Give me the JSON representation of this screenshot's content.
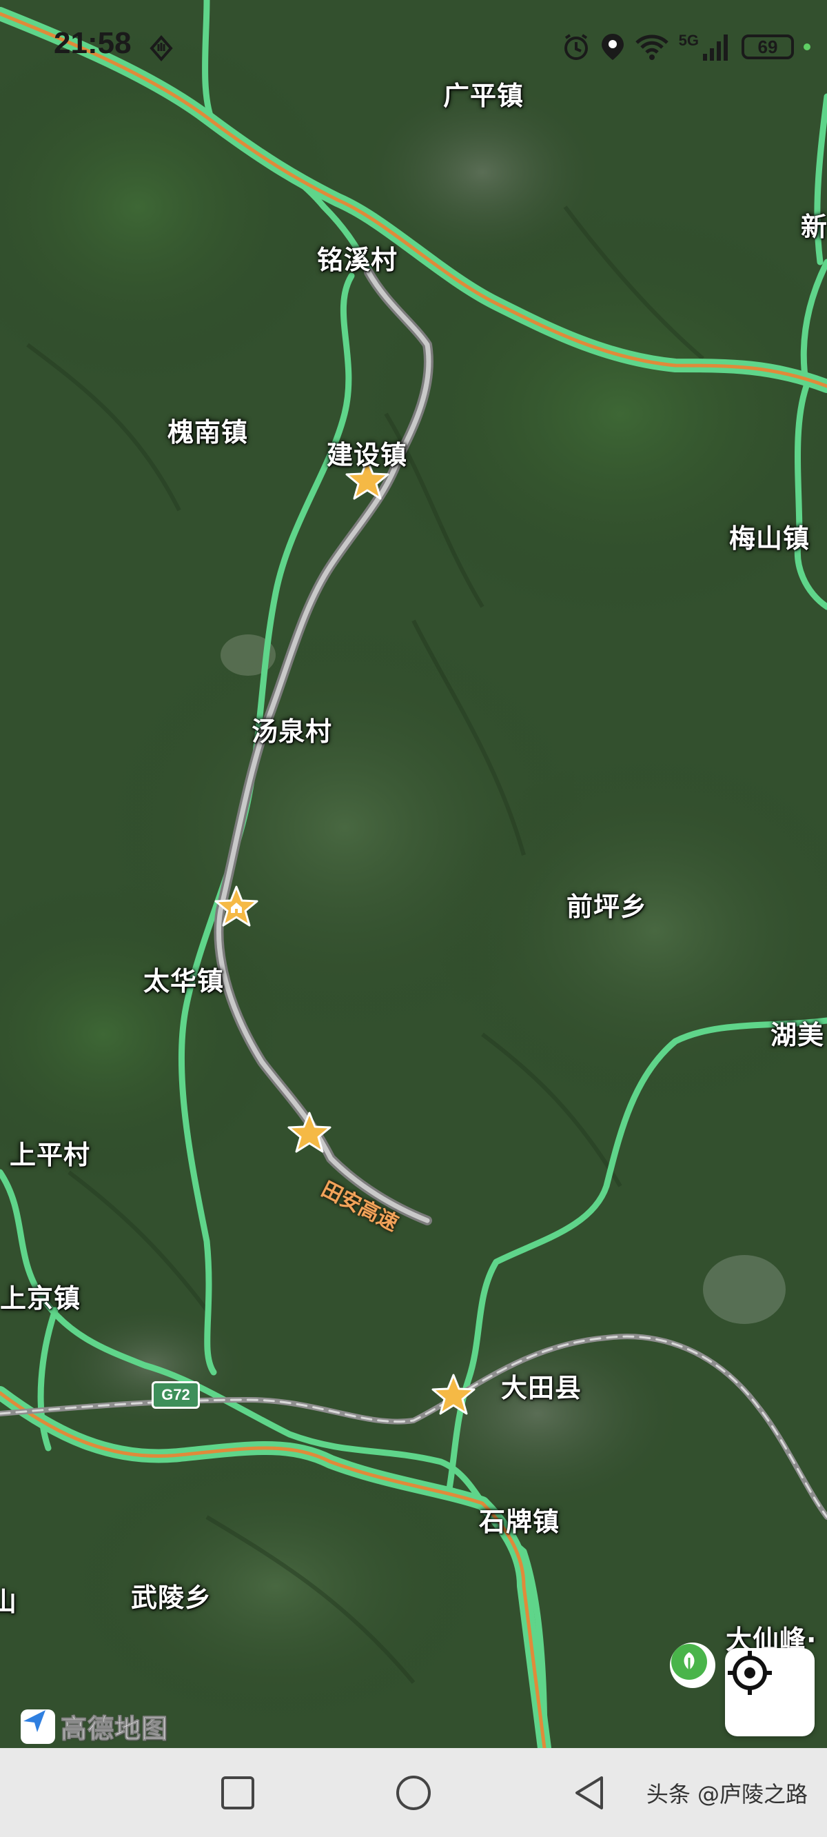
{
  "status_bar": {
    "time": "21:58",
    "battery": "69",
    "network": "5G"
  },
  "map": {
    "places": [
      {
        "id": "guangping",
        "label": "广平镇"
      },
      {
        "id": "xin",
        "label": "新"
      },
      {
        "id": "mingxi",
        "label": "铭溪村"
      },
      {
        "id": "huainan",
        "label": "槐南镇"
      },
      {
        "id": "jianshe",
        "label": "建设镇"
      },
      {
        "id": "meishan",
        "label": "梅山镇"
      },
      {
        "id": "tangquan",
        "label": "汤泉村"
      },
      {
        "id": "qianping",
        "label": "前坪乡"
      },
      {
        "id": "taihua",
        "label": "太华镇"
      },
      {
        "id": "humei",
        "label": "湖美"
      },
      {
        "id": "shangping",
        "label": "上平村"
      },
      {
        "id": "shangjing",
        "label": "上京镇"
      },
      {
        "id": "datian",
        "label": "大田县"
      },
      {
        "id": "shipai",
        "label": "石牌镇"
      },
      {
        "id": "shan",
        "label": "山"
      },
      {
        "id": "wuling",
        "label": "武陵乡"
      },
      {
        "id": "daxianfeng",
        "label": "大仙峰·"
      }
    ],
    "highway_shield": "G72",
    "road_label": "田安高速",
    "logo_text": "高德地图",
    "colors": {
      "highway_green": "#5fd58a",
      "highway_orange": "#e08a3a",
      "rail_gray": "#bdbdbd",
      "star_orange": "#f5b945"
    }
  },
  "nav_bar": {
    "watermark": "头条 @庐陵之路"
  }
}
